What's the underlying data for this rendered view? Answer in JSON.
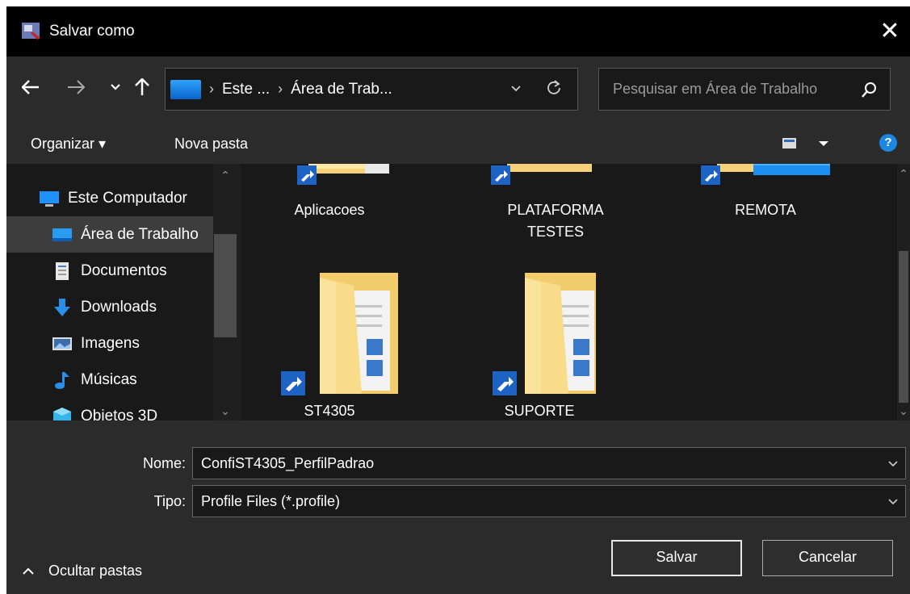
{
  "window": {
    "title": "Salvar como",
    "close": "✕"
  },
  "nav": {
    "crumbs": [
      "Este ...",
      "Área de Trab..."
    ],
    "search_placeholder": "Pesquisar em Área de Trabalho"
  },
  "toolbar": {
    "organize": "Organizar ▾",
    "new_folder": "Nova pasta",
    "help": "?"
  },
  "tree": [
    {
      "label": "Este Computador",
      "icon": "computer-icon"
    },
    {
      "label": "Área de Trabalho",
      "icon": "desktop-icon",
      "selected": true
    },
    {
      "label": "Documentos",
      "icon": "documents-icon"
    },
    {
      "label": "Downloads",
      "icon": "downloads-icon"
    },
    {
      "label": "Imagens",
      "icon": "pictures-icon"
    },
    {
      "label": "Músicas",
      "icon": "music-icon"
    },
    {
      "label": "Objetos 3D",
      "icon": "objects-3d-icon"
    }
  ],
  "folders": {
    "aplicacoes": "Aplicacoes",
    "plataforma": [
      "PLATAFORMA",
      "TESTES"
    ],
    "remota": "REMOTA",
    "st4305": "ST4305",
    "suporte": "SUPORTE"
  },
  "form": {
    "name_label": "Nome:",
    "name_value": "ConfiST4305_PerfilPadrao",
    "type_label": "Tipo:",
    "type_value": "Profile Files (*.profile)"
  },
  "footer": {
    "hide_folders": "Ocultar pastas",
    "save": "Salvar",
    "cancel": "Cancelar"
  }
}
